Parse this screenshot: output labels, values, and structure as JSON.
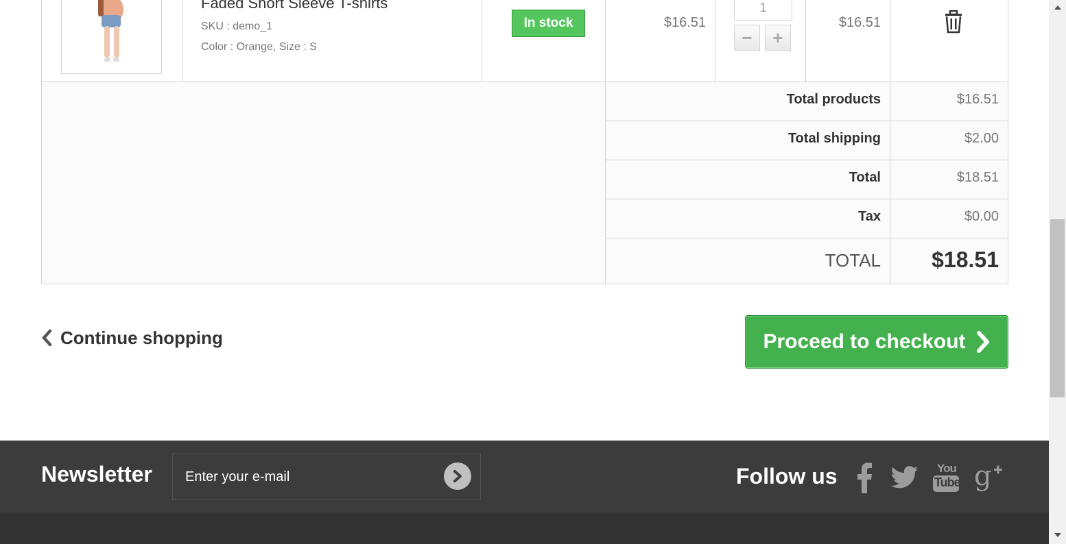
{
  "product": {
    "name": "Faded Short Sleeve T-shirts",
    "sku": "SKU : demo_1",
    "attributes": "Color : Orange, Size : S",
    "availability": "In stock",
    "unit_price": "$16.51",
    "quantity": "1",
    "line_total": "$16.51"
  },
  "summary": {
    "rows": [
      {
        "label": "Total products",
        "value": "$16.51"
      },
      {
        "label": "Total shipping",
        "value": "$2.00"
      },
      {
        "label": "Total",
        "value": "$18.51"
      },
      {
        "label": "Tax",
        "value": "$0.00"
      }
    ],
    "grand_label": "TOTAL",
    "grand_value": "$18.51"
  },
  "actions": {
    "continue_label": "Continue shopping",
    "checkout_label": "Proceed to checkout"
  },
  "footer": {
    "newsletter_title": "Newsletter",
    "newsletter_placeholder": "Enter your e-mail",
    "follow_title": "Follow us",
    "social_icons": [
      "facebook-icon",
      "twitter-icon",
      "youtube-icon",
      "google-plus-icon"
    ],
    "youtube_text_top": "You",
    "youtube_text_bottom": "Tube"
  },
  "colors": {
    "green": "#46a74e",
    "footer_bg": "#3c3c3c",
    "footer_bottom": "#333333"
  }
}
